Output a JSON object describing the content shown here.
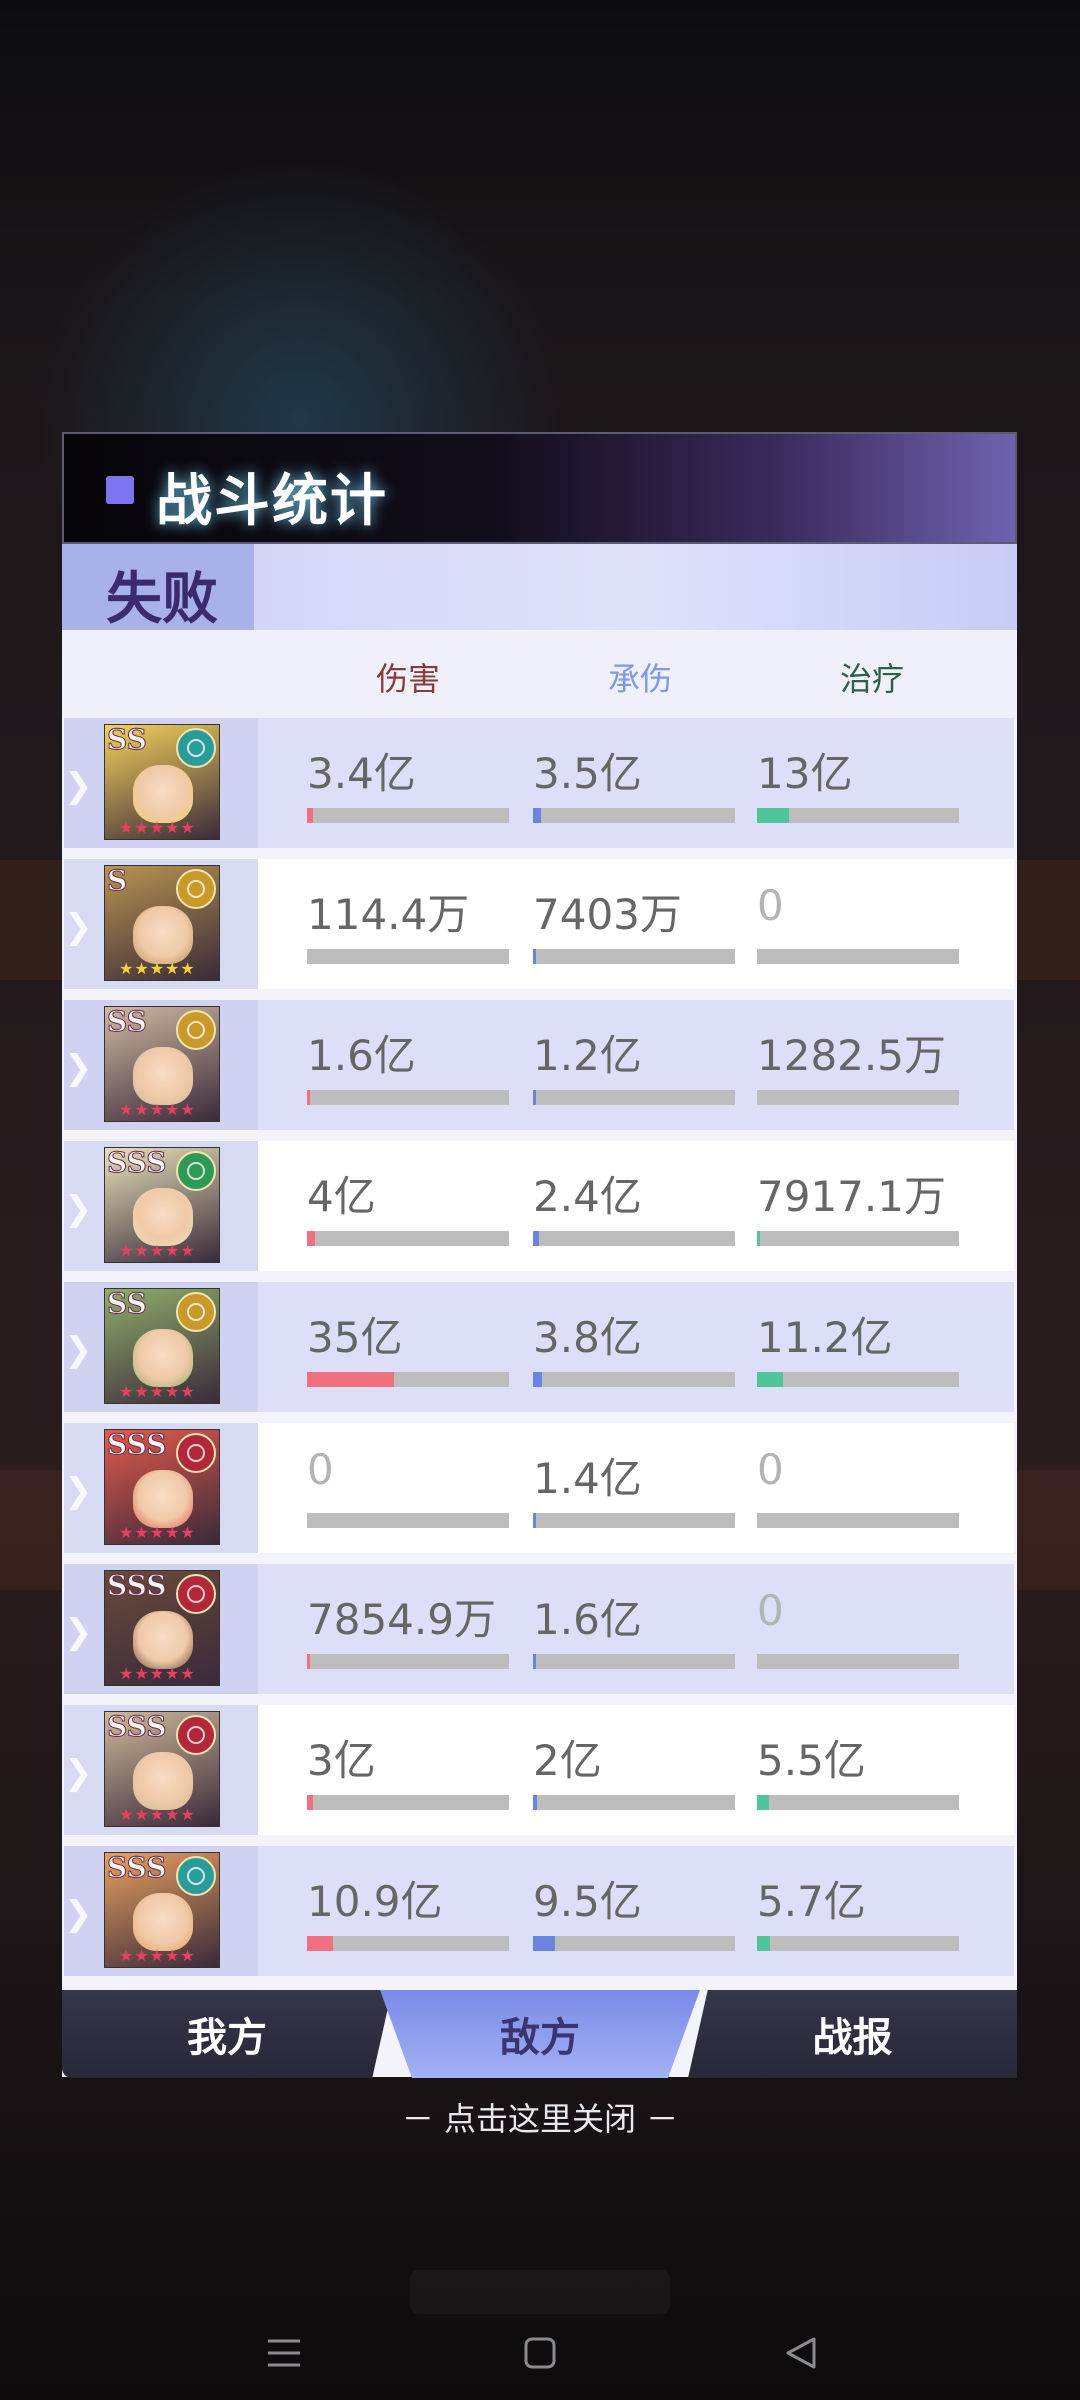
{
  "dialog": {
    "title": "战斗统计",
    "result": "失败",
    "headers": {
      "damage": "伤害",
      "taken": "承伤",
      "heal": "治疗"
    },
    "colors": {
      "damage": "#f1707f",
      "taken": "#6a84e0",
      "heal": "#4fc59a",
      "damage_header": "#8a3a3a",
      "taken_header": "#7f97e8",
      "heal_header": "#2f5f47"
    },
    "rows": [
      {
        "rank": "SS",
        "element": "wind-icon",
        "damage": "3.4亿",
        "damage_pct": 0.03,
        "taken": "3.5亿",
        "taken_pct": 0.04,
        "heal": "13亿",
        "heal_pct": 0.16
      },
      {
        "rank": "S",
        "element": "light-icon",
        "damage": "114.4万",
        "damage_pct": 0.0,
        "taken": "7403万",
        "taken_pct": 0.01,
        "heal": "0",
        "heal_pct": 0.0
      },
      {
        "rank": "SS",
        "element": "light-icon",
        "damage": "1.6亿",
        "damage_pct": 0.015,
        "taken": "1.2亿",
        "taken_pct": 0.012,
        "heal": "1282.5万",
        "heal_pct": 0.0
      },
      {
        "rank": "SSS",
        "element": "nature-icon",
        "damage": "4亿",
        "damage_pct": 0.04,
        "taken": "2.4亿",
        "taken_pct": 0.03,
        "heal": "7917.1万",
        "heal_pct": 0.008
      },
      {
        "rank": "SS",
        "element": "light-icon",
        "damage": "35亿",
        "damage_pct": 0.43,
        "taken": "3.8亿",
        "taken_pct": 0.045,
        "heal": "11.2亿",
        "heal_pct": 0.13
      },
      {
        "rank": "SSS",
        "element": "fire-icon",
        "damage": "0",
        "damage_pct": 0.0,
        "taken": "1.4亿",
        "taken_pct": 0.015,
        "heal": "0",
        "heal_pct": 0.0
      },
      {
        "rank": "SSS",
        "element": "fire-icon",
        "damage": "7854.9万",
        "damage_pct": 0.008,
        "taken": "1.6亿",
        "taken_pct": 0.016,
        "heal": "0",
        "heal_pct": 0.0
      },
      {
        "rank": "SSS",
        "element": "fire-icon",
        "damage": "3亿",
        "damage_pct": 0.03,
        "taken": "2亿",
        "taken_pct": 0.022,
        "heal": "5.5亿",
        "heal_pct": 0.06
      },
      {
        "rank": "SSS",
        "element": "wind-icon",
        "damage": "10.9亿",
        "damage_pct": 0.13,
        "taken": "9.5亿",
        "taken_pct": 0.11,
        "heal": "5.7亿",
        "heal_pct": 0.065
      }
    ]
  },
  "tabs": {
    "mine": "我方",
    "enemy": "敌方",
    "report": "战报",
    "active": "enemy"
  },
  "close_hint": "－ 点击这里关闭 －",
  "navbar": {
    "menu": "menu-icon",
    "home": "home-icon",
    "back": "back-icon"
  }
}
